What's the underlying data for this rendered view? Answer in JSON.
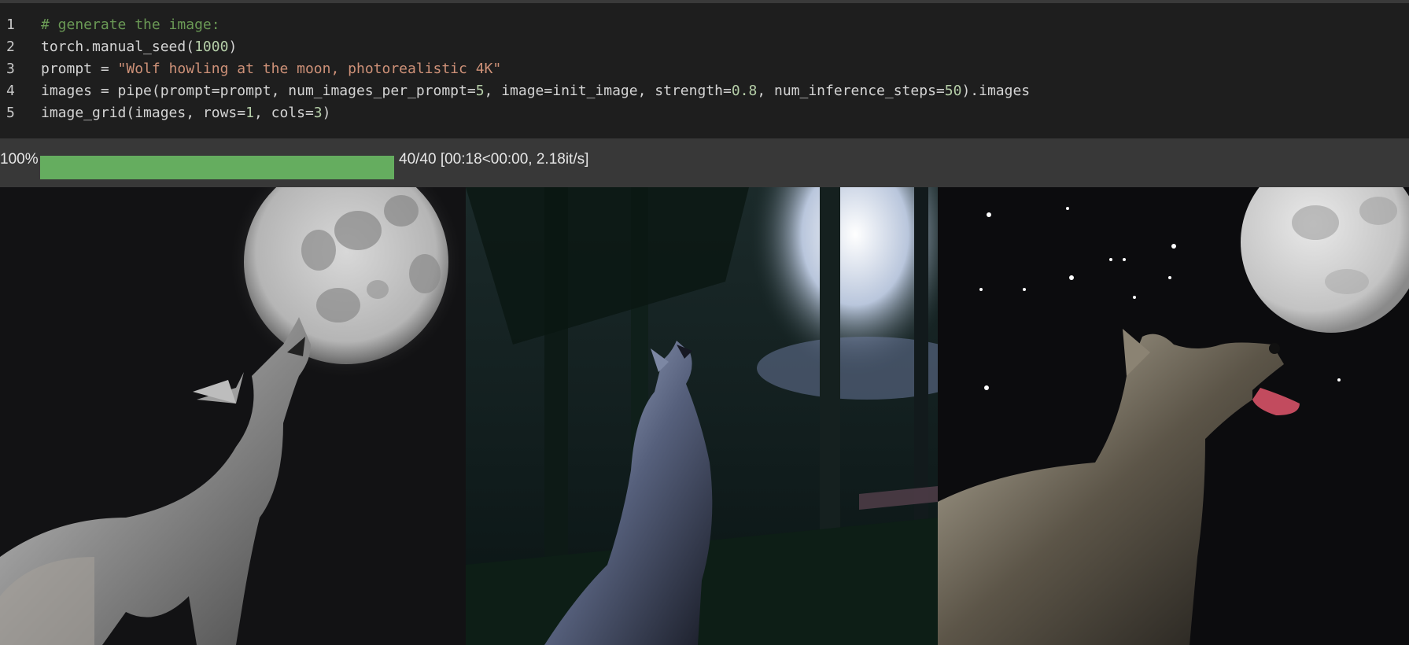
{
  "notebook": {
    "code_lines": [
      {
        "n": "1",
        "segments": [
          {
            "t": "# generate the image:",
            "c": "comment"
          }
        ]
      },
      {
        "n": "2",
        "segments": [
          {
            "t": "torch.manual_seed(",
            "c": "def"
          },
          {
            "t": "1000",
            "c": "num"
          },
          {
            "t": ")",
            "c": "def"
          }
        ]
      },
      {
        "n": "3",
        "segments": [
          {
            "t": "prompt = ",
            "c": "def"
          },
          {
            "t": "\"Wolf howling at the moon, photorealistic 4K\"",
            "c": "str"
          }
        ]
      },
      {
        "n": "4",
        "segments": [
          {
            "t": "images = pipe(prompt=prompt, num_images_per_prompt=",
            "c": "def"
          },
          {
            "t": "5",
            "c": "num"
          },
          {
            "t": ", image=init_image, strength=",
            "c": "def"
          },
          {
            "t": "0.8",
            "c": "num"
          },
          {
            "t": ", num_inference_steps=",
            "c": "def"
          },
          {
            "t": "50",
            "c": "num"
          },
          {
            "t": ").images",
            "c": "def"
          }
        ]
      },
      {
        "n": "5",
        "segments": [
          {
            "t": "image_grid(images, rows=",
            "c": "def"
          },
          {
            "t": "1",
            "c": "num"
          },
          {
            "t": ", cols=",
            "c": "def"
          },
          {
            "t": "3",
            "c": "num"
          },
          {
            "t": ")",
            "c": "def"
          }
        ]
      }
    ]
  },
  "progress": {
    "percent_label": "100%",
    "fraction": 1.0,
    "status_text": "40/40 [00:18<00:00, 2.18it/s]"
  },
  "output_images": [
    {
      "name": "wolf-howling-image-1"
    },
    {
      "name": "wolf-howling-image-2"
    },
    {
      "name": "wolf-howling-image-3"
    }
  ],
  "colors": {
    "editor_bg": "#1e1e1e",
    "output_bg": "#383838",
    "progress_fill": "#65ad5f",
    "comment": "#6a9955",
    "string": "#ce9178",
    "number": "#b5cea8"
  }
}
